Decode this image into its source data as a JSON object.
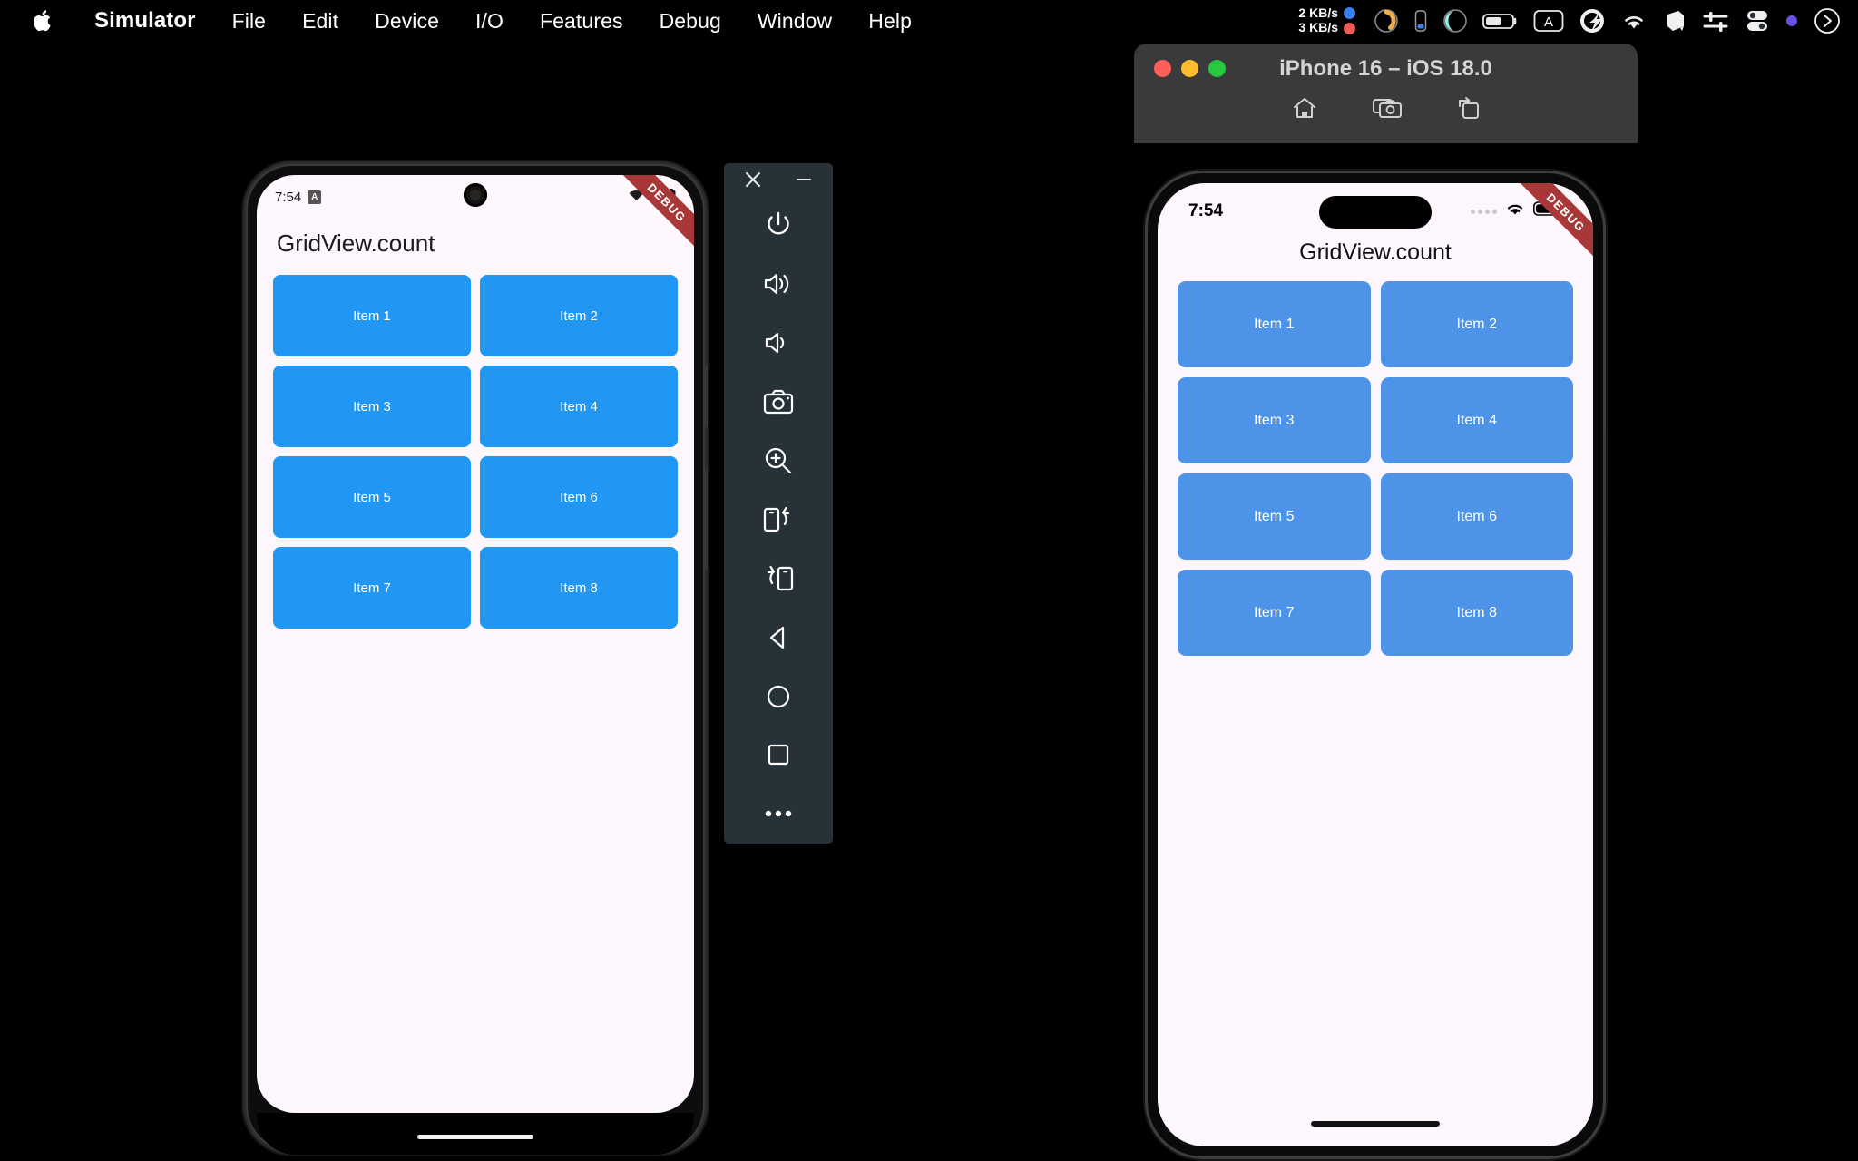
{
  "menubar": {
    "apple_icon": "apple-logo",
    "items": [
      {
        "label": "Simulator",
        "bold": true
      },
      {
        "label": "File"
      },
      {
        "label": "Edit"
      },
      {
        "label": "Device"
      },
      {
        "label": "I/O"
      },
      {
        "label": "Features"
      },
      {
        "label": "Debug"
      },
      {
        "label": "Window"
      },
      {
        "label": "Help"
      }
    ],
    "network": {
      "upload": "2 KB/s",
      "download": "3 KB/s",
      "upload_dot_color": "#3b7ef0",
      "download_dot_color": "#ef5a5a"
    },
    "status_icons": [
      "cpu-gauge-icon",
      "battery-vertical-icon",
      "moon-contrast-icon",
      "battery-icon",
      "keyboard-input-A-icon",
      "quickshade-icon",
      "wifi-icon",
      "dropbox-cube-icon",
      "sliders-icon",
      "toggles-icon",
      "purple-dot-icon",
      "control-center-icon"
    ]
  },
  "android": {
    "status_bar": {
      "time": "7:54",
      "badge_letter": "A",
      "icons": [
        "wifi-icon",
        "cellular-signal-icon",
        "battery-icon"
      ]
    },
    "debug_banner": "DEBUG",
    "app_title": "GridView.count",
    "grid_items": [
      "Item 1",
      "Item 2",
      "Item 3",
      "Item 4",
      "Item 5",
      "Item 6",
      "Item 7",
      "Item 8"
    ],
    "tile_color": "#2196F3",
    "screen_background": "#FDF6FD"
  },
  "emulator_toolbar": {
    "window_buttons": [
      {
        "name": "close-icon",
        "label": "×"
      },
      {
        "name": "minimize-icon",
        "label": "−"
      }
    ],
    "buttons": [
      {
        "name": "power-icon",
        "label": "Power"
      },
      {
        "name": "volume-up-icon",
        "label": "Volume Up"
      },
      {
        "name": "volume-down-icon",
        "label": "Volume Down"
      },
      {
        "name": "screenshot-camera-icon",
        "label": "Take Screenshot"
      },
      {
        "name": "zoom-in-icon",
        "label": "Enable Zoom"
      },
      {
        "name": "rotate-left-icon",
        "label": "Rotate Left"
      },
      {
        "name": "rotate-right-icon",
        "label": "Rotate Right"
      },
      {
        "name": "back-icon",
        "label": "Back"
      },
      {
        "name": "home-icon",
        "label": "Home"
      },
      {
        "name": "overview-icon",
        "label": "Overview"
      },
      {
        "name": "more-icon",
        "label": "More"
      }
    ]
  },
  "ios_window": {
    "title": "iPhone 16 – iOS 18.0",
    "traffic_lights": [
      {
        "name": "close-button",
        "color": "#ff5f57"
      },
      {
        "name": "minimize-button",
        "color": "#febc2e"
      },
      {
        "name": "zoom-button",
        "color": "#28c840"
      }
    ],
    "toolbar_buttons": [
      {
        "name": "home-icon",
        "label": "Home"
      },
      {
        "name": "screenshot-icon",
        "label": "Screenshot"
      },
      {
        "name": "rotate-icon",
        "label": "Rotate"
      }
    ]
  },
  "ios": {
    "status_bar": {
      "time": "7:54",
      "icons": [
        "cellular-dots-icon",
        "wifi-icon",
        "battery-icon"
      ]
    },
    "debug_banner": "DEBUG",
    "app_title": "GridView.count",
    "grid_items": [
      "Item 1",
      "Item 2",
      "Item 3",
      "Item 4",
      "Item 5",
      "Item 6",
      "Item 7",
      "Item 8"
    ],
    "tile_color": "#4D94E8",
    "screen_background": "#FDF6FD"
  }
}
